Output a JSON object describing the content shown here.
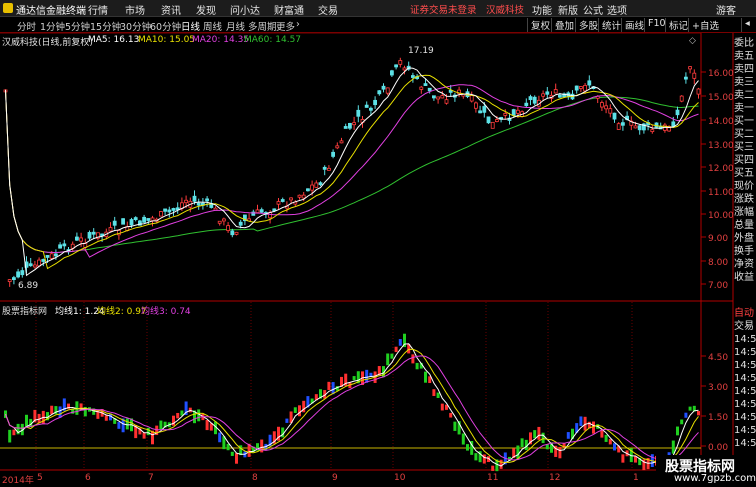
{
  "titlebar": {
    "app_title": "通达信金融终端",
    "menus": [
      "行情",
      "市场",
      "资讯",
      "发现",
      "问小达",
      "财富通",
      "交易"
    ],
    "notice": "证券交易未登录",
    "stock_name": "汉威科技",
    "right_menus": [
      "功能",
      "新版",
      "公式",
      "选项"
    ],
    "guest": "游客"
  },
  "toolbar": {
    "periods": [
      "分时",
      "1分钟",
      "5分钟",
      "15分钟",
      "30分钟",
      "60分钟",
      "日线",
      "周线",
      "月线",
      "多周期",
      "更多"
    ],
    "active_period": "日线",
    "more_arrow": "›",
    "buttons": [
      "复权",
      "叠加",
      "多股",
      "统计",
      "画线",
      "F10",
      "标记",
      "+自选"
    ],
    "back_arrow": "◂"
  },
  "price_chart": {
    "title": "汉威科技(日线,前复权)",
    "ma5": "MA5: 16.13",
    "ma10": "MA10: 15.05",
    "ma20": "MA20: 14.35",
    "ma60": "MA60: 14.57",
    "colors": {
      "ma5": "#ffffff",
      "ma10": "#e8e000",
      "ma20": "#e040e0",
      "ma60": "#30c030"
    },
    "high_label": "17.19",
    "low_label": "6.89",
    "axis_labels": [
      "16.00",
      "15.00",
      "14.00",
      "13.00",
      "12.00",
      "11.00",
      "10.00",
      "9.00",
      "8.00",
      "7.00"
    ]
  },
  "indicator": {
    "title": "股票指标网",
    "line1": "均线1: 1.24",
    "line2": "均线2: 0.97",
    "line3": "均线3: 0.74",
    "colors": {
      "line1": "#ffffff",
      "line2": "#e8e000",
      "line3": "#e040e0"
    },
    "axis_labels": [
      "4.50",
      "3.00",
      "1.50",
      "0.00"
    ]
  },
  "side_panel": {
    "items": [
      "委比",
      "卖五",
      "卖四",
      "卖三",
      "卖二",
      "卖一",
      "买一",
      "买二",
      "买三",
      "买四",
      "买五",
      "现价",
      "涨跌",
      "涨幅",
      "总量",
      "外盘",
      "换手",
      "净资",
      "收益"
    ],
    "bottom_items": [
      "自动",
      "交易",
      "14:5",
      "14:5",
      "14:5",
      "14:5",
      "14:5",
      "14:5",
      "14:5",
      "14:5",
      "14:5"
    ]
  },
  "date_axis": {
    "labels": [
      "2014年",
      "5",
      "6",
      "7",
      "8",
      "9",
      "10",
      "11",
      "12",
      "1"
    ]
  },
  "watermark": {
    "line1": "股票指标网",
    "line2": "www.7gpzb.com"
  }
}
